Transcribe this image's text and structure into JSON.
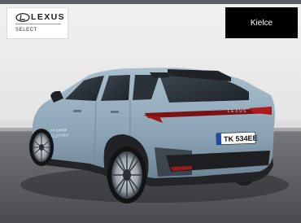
{
  "dealer": {
    "logo_text": "LEXUS",
    "logo_subtext": "SELECT",
    "logo_icon": "lexus-emblem-icon",
    "city": "Kielce"
  },
  "vehicle": {
    "license_plate": "TK 534EE",
    "rear_badge": "LEXUS",
    "side_text": "ELECTRIC",
    "body_color": "#8ea7b8"
  }
}
